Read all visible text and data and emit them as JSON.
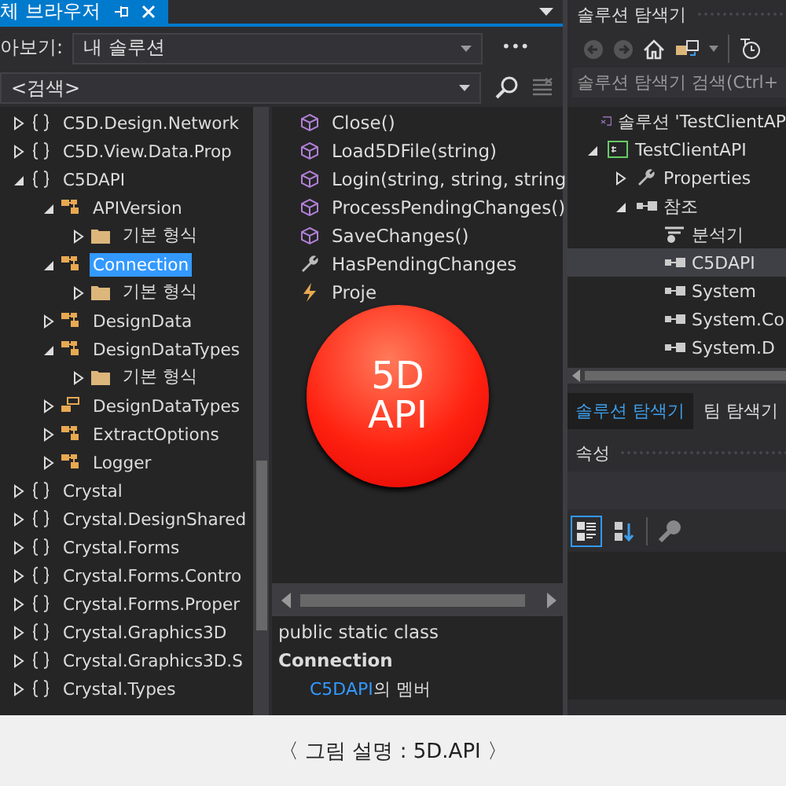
{
  "object_browser": {
    "tab_title": "체 브라우저",
    "browse_label": "아보기:",
    "browse_value": "내 솔루션",
    "more": "•••",
    "search_placeholder": "<검색>",
    "tree": [
      {
        "label": "C5D.Design.Network",
        "kind": "namespace",
        "expanded": false,
        "selected": false
      },
      {
        "label": "C5D.View.Data.Prop",
        "kind": "namespace",
        "expanded": false,
        "selected": false
      },
      {
        "label": "C5DAPI",
        "kind": "namespace",
        "expanded": true,
        "selected": false,
        "children": [
          {
            "label": "APIVersion",
            "kind": "class",
            "expanded": true,
            "selected": false,
            "children": [
              {
                "label": "기본 형식",
                "kind": "folder",
                "expanded": false,
                "selected": false
              }
            ]
          },
          {
            "label": "Connection",
            "kind": "class",
            "expanded": true,
            "selected": true,
            "children": [
              {
                "label": "기본 형식",
                "kind": "folder",
                "expanded": false,
                "selected": false
              }
            ]
          },
          {
            "label": "DesignData",
            "kind": "class",
            "expanded": false,
            "selected": false
          },
          {
            "label": "DesignDataTypes",
            "kind": "class",
            "expanded": true,
            "selected": false,
            "children": [
              {
                "label": "기본 형식",
                "kind": "folder",
                "expanded": false,
                "selected": false
              }
            ]
          },
          {
            "label": "DesignDataTypes",
            "kind": "enum",
            "expanded": false,
            "selected": false
          },
          {
            "label": "ExtractOptions",
            "kind": "class",
            "expanded": false,
            "selected": false
          },
          {
            "label": "Logger",
            "kind": "class",
            "expanded": false,
            "selected": false
          }
        ]
      },
      {
        "label": "Crystal",
        "kind": "namespace",
        "expanded": false,
        "selected": false
      },
      {
        "label": "Crystal.DesignShared",
        "kind": "namespace",
        "expanded": false,
        "selected": false
      },
      {
        "label": "Crystal.Forms",
        "kind": "namespace",
        "expanded": false,
        "selected": false
      },
      {
        "label": "Crystal.Forms.Contro",
        "kind": "namespace",
        "expanded": false,
        "selected": false
      },
      {
        "label": "Crystal.Forms.Proper",
        "kind": "namespace",
        "expanded": false,
        "selected": false
      },
      {
        "label": "Crystal.Graphics3D",
        "kind": "namespace",
        "expanded": false,
        "selected": false
      },
      {
        "label": "Crystal.Graphics3D.S",
        "kind": "namespace",
        "expanded": false,
        "selected": false
      },
      {
        "label": "Crystal.Types",
        "kind": "namespace",
        "expanded": false,
        "selected": false
      }
    ],
    "members": [
      {
        "label": "Close()",
        "kind": "method"
      },
      {
        "label": "Load5DFile(string)",
        "kind": "method"
      },
      {
        "label": "Login(string, string, string",
        "kind": "method"
      },
      {
        "label": "ProcessPendingChanges()",
        "kind": "method"
      },
      {
        "label": "SaveChanges()",
        "kind": "method"
      },
      {
        "label": "HasPendingChanges",
        "kind": "property"
      },
      {
        "label": "Proje",
        "kind": "event"
      }
    ],
    "badge": "5D API",
    "description": {
      "signature": "public static class",
      "name": "Connection",
      "link": "C5DAPI",
      "member_of": "의 멤버"
    }
  },
  "solution_explorer": {
    "title": "솔루션 탐색기",
    "search_placeholder": "솔루션 탐색기 검색(Ctrl+",
    "tree": [
      {
        "label": "솔루션 'TestClientAP",
        "kind": "solution",
        "selected": false
      },
      {
        "label": "TestClientAPI",
        "kind": "project",
        "expanded": true,
        "selected": false,
        "children": [
          {
            "label": "Properties",
            "kind": "wrench",
            "expanded": false,
            "selected": false
          },
          {
            "label": "참조",
            "kind": "reference",
            "expanded": true,
            "selected": false,
            "children": [
              {
                "label": "분석기",
                "kind": "analyzer",
                "selected": false
              },
              {
                "label": "C5DAPI",
                "kind": "reference",
                "selected": true
              },
              {
                "label": "System",
                "kind": "reference",
                "selected": false
              },
              {
                "label": "System.Co",
                "kind": "reference",
                "selected": false
              },
              {
                "label": "System.D",
                "kind": "reference",
                "selected": false
              }
            ]
          }
        ]
      }
    ]
  },
  "bottom_tabs": [
    {
      "label": "솔루션 탐색기",
      "selected": true
    },
    {
      "label": "팀 탐색기",
      "selected": false
    }
  ],
  "properties": {
    "title": "속성",
    "tools": [
      {
        "kind": "categorized",
        "selected": true
      },
      {
        "kind": "alphabetical",
        "selected": false
      },
      {
        "kind": "pages",
        "selected": false
      }
    ]
  },
  "caption": "〈 그림 설명 : 5D.API 〉"
}
